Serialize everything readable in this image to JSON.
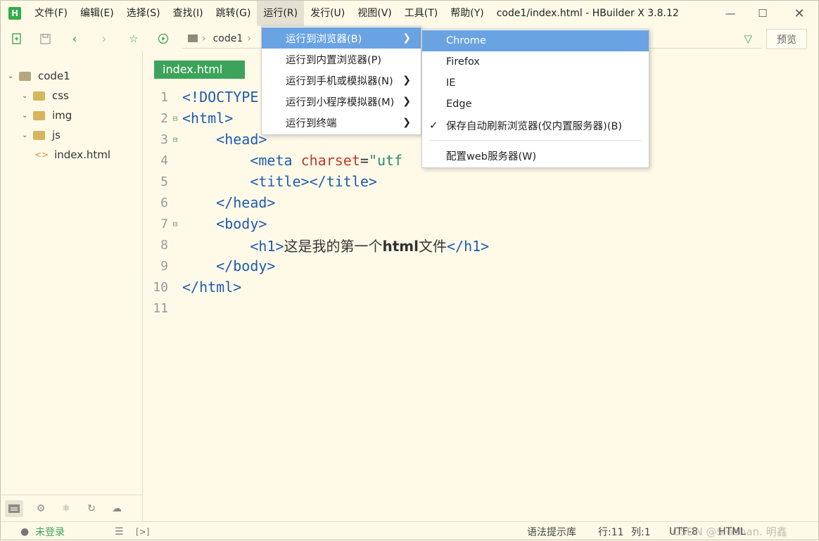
{
  "app": {
    "logo": "H",
    "window_title": "code1/index.html - HBuilder X 3.8.12",
    "menus": [
      "文件(F)",
      "编辑(E)",
      "选择(S)",
      "查找(I)",
      "跳转(G)",
      "运行(R)",
      "发行(U)",
      "视图(V)",
      "工具(T)",
      "帮助(Y)"
    ]
  },
  "toolbar": {
    "breadcrumb": "code1",
    "preview_label": "预览"
  },
  "sidebar": {
    "tree": [
      {
        "label": "code1",
        "type": "project"
      },
      {
        "label": "css",
        "type": "folder"
      },
      {
        "label": "img",
        "type": "folder"
      },
      {
        "label": "js",
        "type": "folder"
      },
      {
        "label": "index.html",
        "type": "file"
      }
    ]
  },
  "editor": {
    "tab_label": "index.html",
    "line_numbers": [
      "1",
      "2",
      "3",
      "4",
      "5",
      "6",
      "7",
      "8",
      "9",
      "10",
      "11"
    ]
  },
  "run_menu": {
    "items": [
      {
        "label": "运行到浏览器(B)",
        "has_submenu": true
      },
      {
        "label": "运行到内置浏览器(P)",
        "has_submenu": false
      },
      {
        "label": "运行到手机或模拟器(N)",
        "has_submenu": true
      },
      {
        "label": "运行到小程序模拟器(M)",
        "has_submenu": true
      },
      {
        "label": "运行到终端",
        "has_submenu": true
      }
    ]
  },
  "browser_submenu": {
    "items": [
      {
        "label": "Chrome"
      },
      {
        "label": "Firefox"
      },
      {
        "label": "IE"
      },
      {
        "label": "Edge"
      },
      {
        "label": "保存自动刷新浏览器(仅内置服务器)(B)",
        "checked": true
      },
      {
        "label": "配置web服务器(W)"
      }
    ]
  },
  "status": {
    "login": "未登录",
    "syntax_lib": "语法提示库",
    "row": "行:11",
    "col": "列:1",
    "encoding": "UTF-8",
    "language": "HTML",
    "watermark": "CSDN @Siobhan. 明鑫"
  },
  "colors": {
    "accent_green": "#3da35a",
    "menu_highlight": "#6aa3e2",
    "background": "#fffae8"
  }
}
